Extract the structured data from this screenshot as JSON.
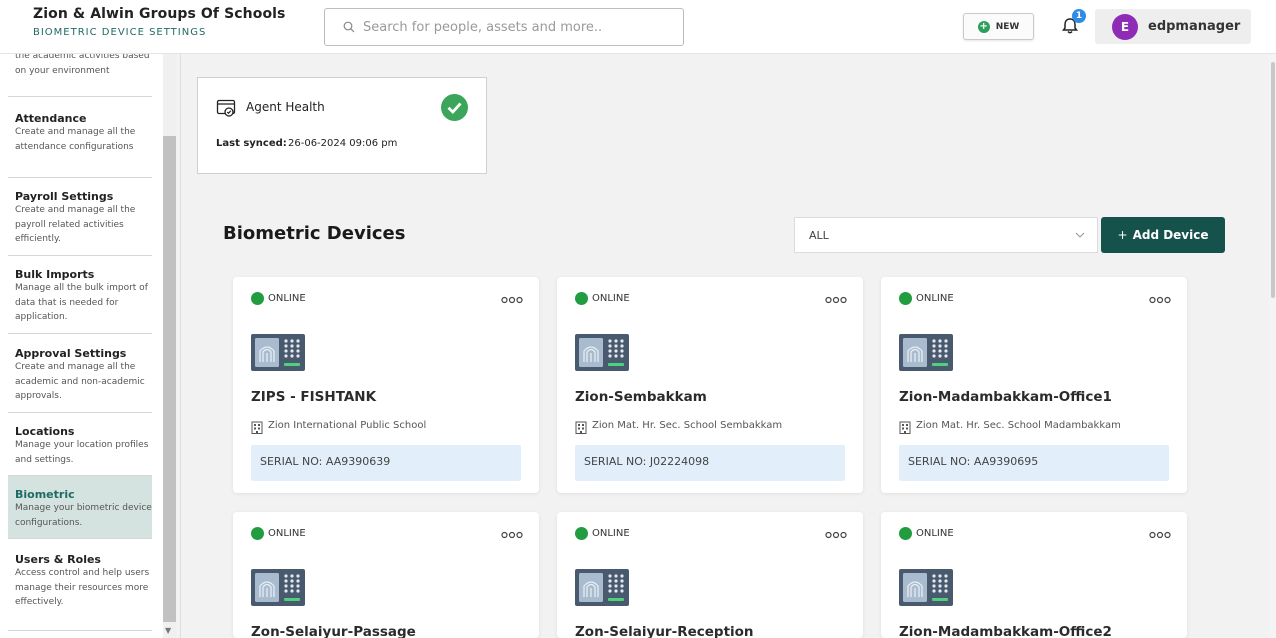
{
  "header": {
    "org_title": "Zion & Alwin Groups Of Schools",
    "org_subtitle": "BIOMETRIC DEVICE SETTINGS",
    "search_placeholder": "Search for people, assets and more..",
    "new_label": "NEW",
    "notification_count": "1",
    "user_initial": "E",
    "username": "edpmanager"
  },
  "sidebar": {
    "items": [
      {
        "title": "",
        "desc": "the academic activities based on your environment"
      },
      {
        "title": "Attendance",
        "desc": "Create and manage all the attendance configurations"
      },
      {
        "title": "Payroll Settings",
        "desc": "Create and manage all the payroll related activities efficiently."
      },
      {
        "title": "Bulk Imports",
        "desc": "Manage all the bulk import of data that is needed for application."
      },
      {
        "title": "Approval Settings",
        "desc": "Create and manage all the academic and non-academic approvals."
      },
      {
        "title": "Locations",
        "desc": "Manage your location profiles and settings."
      },
      {
        "title": "Biometric",
        "desc": "Manage your biometric device configurations."
      },
      {
        "title": "Users & Roles",
        "desc": "Access control and help users manage their resources more effectively."
      }
    ]
  },
  "agent": {
    "title": "Agent Health",
    "sync_label": "Last synced:",
    "sync_value": "26-06-2024 09:06 pm"
  },
  "devices_section": {
    "title": "Biometric Devices",
    "filter_value": "ALL",
    "add_label": "Add Device"
  },
  "devices": [
    {
      "status": "ONLINE",
      "name": "ZIPS - FISHTANK",
      "school": "Zion International Public School",
      "serial": "SERIAL NO: AA9390639"
    },
    {
      "status": "ONLINE",
      "name": "Zion-Sembakkam",
      "school": "Zion Mat. Hr. Sec. School Sembakkam",
      "serial": "SERIAL NO: J02224098"
    },
    {
      "status": "ONLINE",
      "name": "Zion-Madambakkam-Office1",
      "school": "Zion Mat. Hr. Sec. School Madambakkam",
      "serial": "SERIAL NO: AA9390695"
    },
    {
      "status": "ONLINE",
      "name": "Zon-Selaiyur-Passage",
      "school": "",
      "serial": ""
    },
    {
      "status": "ONLINE",
      "name": "Zon-Selaiyur-Reception",
      "school": "",
      "serial": ""
    },
    {
      "status": "ONLINE",
      "name": "Zion-Madambakkam-Office2",
      "school": "",
      "serial": ""
    }
  ],
  "colors": {
    "accent_teal": "#15524c",
    "online_green": "#1f9d3f",
    "serial_bg": "#e2eef9",
    "avatar_purple": "#8e2cb6"
  }
}
